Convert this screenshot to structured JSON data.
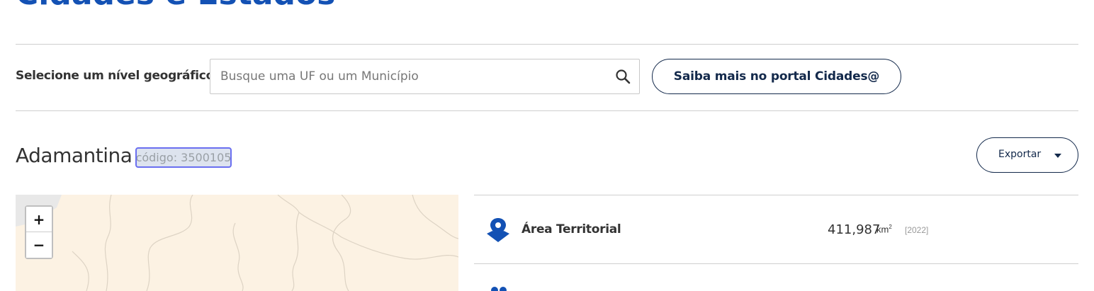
{
  "header": {
    "title": "Cidades e Estados"
  },
  "filter": {
    "label": "Selecione um nível geográfico",
    "search_placeholder": "Busque uma UF ou um Município",
    "portal_button": "Saiba mais no portal Cidades@"
  },
  "location": {
    "name": "Adamantina",
    "code_label": "código: 3500105",
    "export_label": "Exportar"
  },
  "map": {
    "zoom_in": "+",
    "zoom_out": "−"
  },
  "indicators": [
    {
      "label": "Área Territorial",
      "value": "411,987",
      "unit": "km",
      "unit_sup": "2",
      "year": "[2022]",
      "icon": "map-pin-icon"
    }
  ],
  "colors": {
    "accent": "#1351b4",
    "navy": "#13294b",
    "map_bg": "#fcf2e3"
  }
}
